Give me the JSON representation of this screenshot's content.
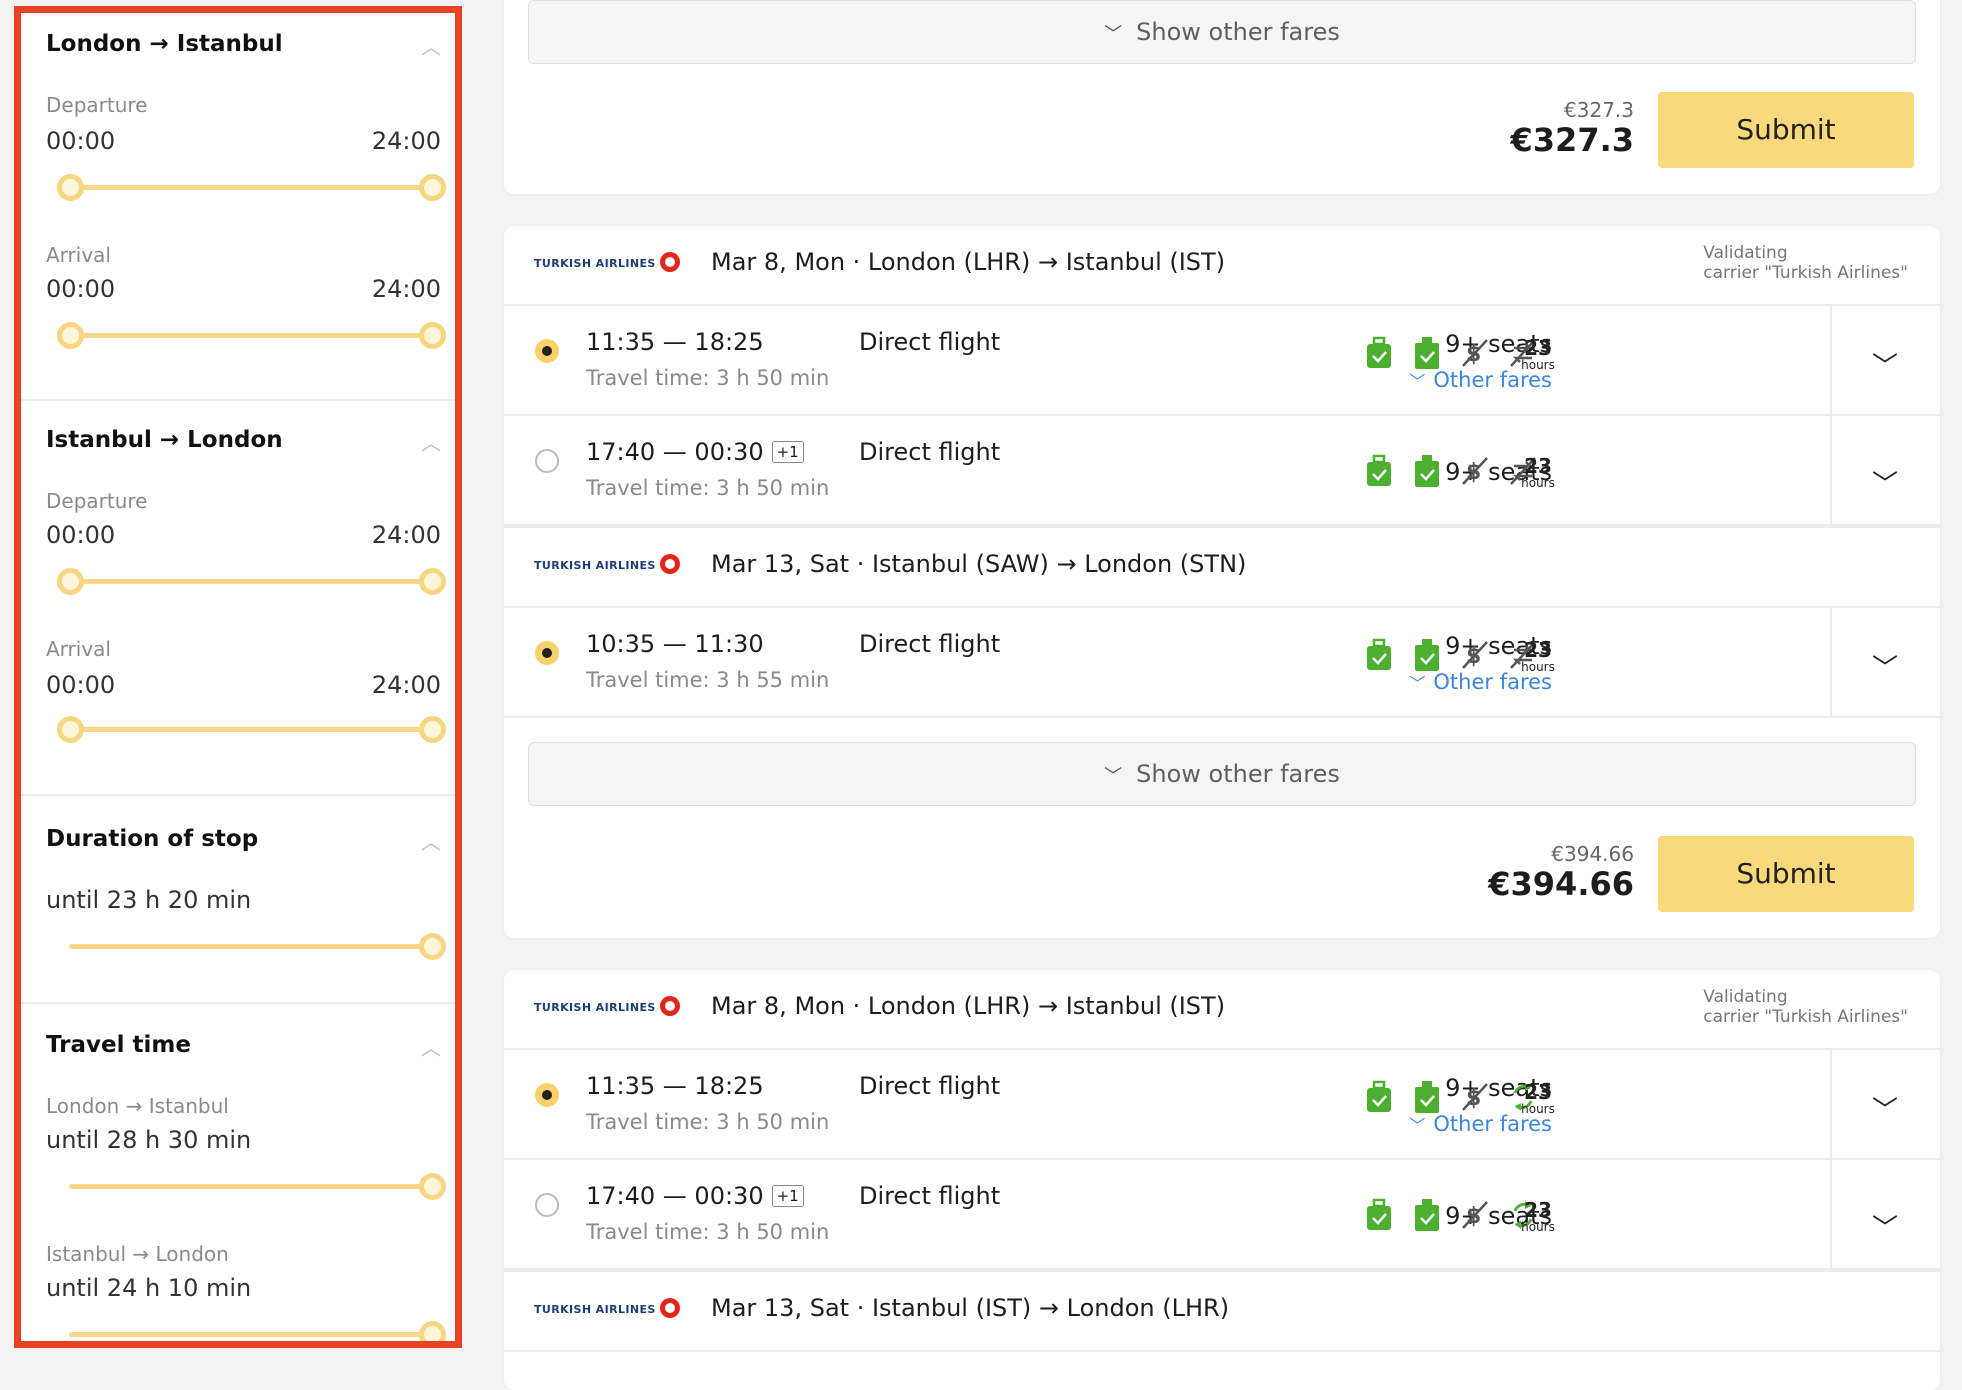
{
  "sidebar": {
    "out": {
      "title": "London → Istanbul",
      "dep_label": "Departure",
      "dep_from": "00:00",
      "dep_to": "24:00",
      "arr_label": "Arrival",
      "arr_from": "00:00",
      "arr_to": "24:00"
    },
    "ret": {
      "title": "Istanbul → London",
      "dep_label": "Departure",
      "dep_from": "00:00",
      "dep_to": "24:00",
      "arr_label": "Arrival",
      "arr_from": "00:00",
      "arr_to": "24:00"
    },
    "stop": {
      "title": "Duration of stop",
      "value": "until 23 h 20 min"
    },
    "travel": {
      "title": "Travel time",
      "out_label": "London → Istanbul",
      "out_value": "until 28 h 30 min",
      "ret_label": "Istanbul → London",
      "ret_value": "until 24 h 10 min"
    }
  },
  "common": {
    "show_other_fares": "Show other fares",
    "submit": "Submit",
    "airline": "TURKISH AIRLINES",
    "validating_line1": "Validating",
    "validating_line2": "carrier \"Turkish Airlines\"",
    "direct": "Direct flight",
    "seats": "9+ seats",
    "other_fares": "Other fares",
    "hours_num": "23",
    "hours_unit": "hours",
    "plus_one": "+1"
  },
  "card1": {
    "old_price": "€327.3",
    "price": "€327.3"
  },
  "card2": {
    "seg1_route": "Mar 8, Mon · London (LHR) → Istanbul (IST)",
    "f1_times": "11:35 — 18:25",
    "f1_tt": "Travel time: 3 h 50 min",
    "f2_times": "17:40 — 00:30",
    "f2_tt": "Travel time: 3 h 50 min",
    "seg2_route": "Mar 13, Sat · Istanbul (SAW) → London (STN)",
    "f3_times": "10:35 — 11:30",
    "f3_tt": "Travel time: 3 h 55 min",
    "old_price": "€394.66",
    "price": "€394.66"
  },
  "card3": {
    "seg1_route": "Mar 8, Mon · London (LHR) → Istanbul (IST)",
    "f1_times": "11:35 — 18:25",
    "f1_tt": "Travel time: 3 h 50 min",
    "f2_times": "17:40 — 00:30",
    "f2_tt": "Travel time: 3 h 50 min",
    "seg2_route": "Mar 13, Sat · Istanbul (IST) → London (LHR)"
  },
  "colors": {
    "accent": "#fad87c",
    "slider": "#f8d888",
    "link": "#3c85dc",
    "luggage": "#4caf2f",
    "highlight": "#e64425"
  },
  "icons": [
    "chevron-up-icon",
    "chevron-down-icon",
    "cabin-bag-icon",
    "checked-bag-icon",
    "no-refund-icon",
    "no-exchange-icon",
    "exchange-icon",
    "expand-icon"
  ]
}
